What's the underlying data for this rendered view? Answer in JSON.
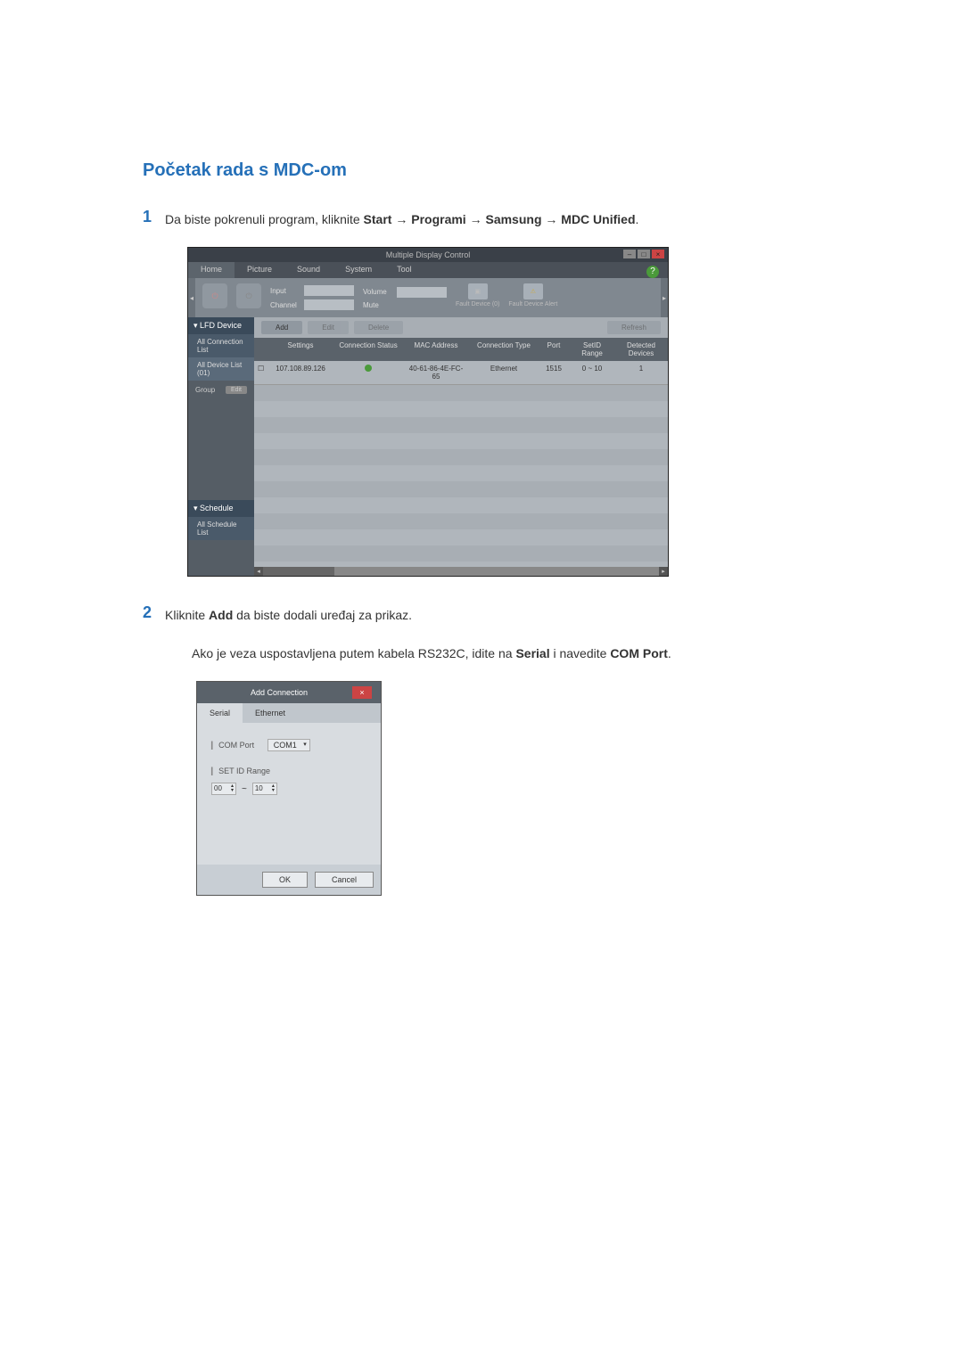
{
  "title": "Početak rada s MDC-om",
  "steps": {
    "1": {
      "num": "1",
      "text_prefix": "Da biste pokrenuli program, kliknite ",
      "path": [
        "Start",
        "Programi",
        "Samsung",
        "MDC Unified"
      ],
      "sep": " → "
    },
    "2": {
      "num": "2",
      "text_prefix": "Kliknite ",
      "bold": "Add",
      "text_suffix": " da biste dodali uređaj za prikaz."
    }
  },
  "sub": {
    "prefix": "Ako je veza uspostavljena putem kabela RS232C, idite na ",
    "b1": "Serial",
    "mid": " i navedite ",
    "b2": "COM Port",
    "suffix": "."
  },
  "mdc": {
    "window_title": "Multiple Display Control",
    "tabs": [
      "Home",
      "Picture",
      "Sound",
      "System",
      "Tool"
    ],
    "toolbar": {
      "input_label": "Input",
      "channel_label": "Channel",
      "volume_label": "Volume",
      "mute_label": "Mute",
      "fault_device": "Fault Device\n(0)",
      "fault_alert": "Fault Device\nAlert"
    },
    "side": {
      "lfd": "LFD Device",
      "all_conn": "All Connection List",
      "all_dev": "All Device List (01)",
      "group": "Group",
      "edit": "Edit",
      "schedule": "Schedule",
      "all_sched": "All Schedule List"
    },
    "main": {
      "add": "Add",
      "edit": "Edit",
      "delete": "Delete",
      "refresh": "Refresh"
    },
    "headers": [
      "",
      "Settings",
      "Connection Status",
      "MAC Address",
      "Connection Type",
      "Port",
      "SetID Range",
      "Detected Devices"
    ],
    "row": [
      "",
      "107.108.89.126",
      "",
      "40-61-86-4E-FC-65",
      "Ethernet",
      "1515",
      "0 ~ 10",
      "1"
    ]
  },
  "dialog": {
    "title": "Add Connection",
    "tabs": [
      "Serial",
      "Ethernet"
    ],
    "comport_label": "COM Port",
    "comport_value": "COM1",
    "setid_label": "SET ID Range",
    "range_from": "00",
    "range_sep": "~",
    "range_to": "10",
    "ok": "OK",
    "cancel": "Cancel"
  }
}
